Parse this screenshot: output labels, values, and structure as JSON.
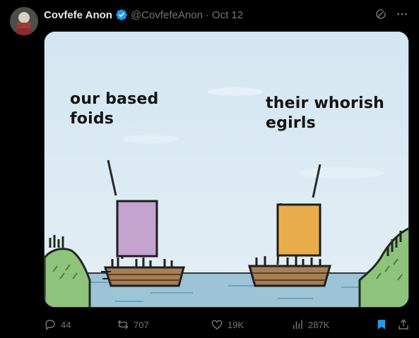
{
  "author": {
    "display_name": "Covfefe Anon",
    "handle": "@CovfefeAnon",
    "separator": "·",
    "date": "Oct 12",
    "verified_icon": "verified-badge-icon"
  },
  "top_actions": {
    "grok_icon": "grok-icon",
    "more_icon": "more-icon"
  },
  "media": {
    "caption_left": "our based\nfoids",
    "caption_right": "their whorish\negirls"
  },
  "metrics": {
    "replies": "44",
    "reposts": "707",
    "likes": "19K",
    "views": "287K"
  },
  "colors": {
    "background": "#000000",
    "text_primary": "#e7e9ea",
    "text_secondary": "#71767b",
    "accent": "#1d9bf0",
    "sail_left": "#c4a3cf",
    "sail_right": "#e8ad4a"
  }
}
